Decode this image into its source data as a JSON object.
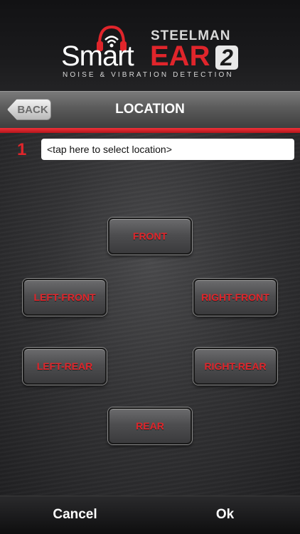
{
  "brand": {
    "company": "STEELMAN",
    "product_prefix": "Smart",
    "product_main": "EAR",
    "product_version": "2",
    "tagline": "NOISE & VIBRATION DETECTION",
    "accent_color": "#e0252b"
  },
  "nav": {
    "back_label": "BACK",
    "title": "LOCATION"
  },
  "location": {
    "number": "1",
    "value": "<tap here to select location>"
  },
  "locations": {
    "front": "FRONT",
    "left_front": "LEFT-FRONT",
    "right_front": "RIGHT-FRONT",
    "left_rear": "LEFT-REAR",
    "right_rear": "RIGHT-REAR",
    "rear": "REAR"
  },
  "footer": {
    "cancel_label": "Cancel",
    "ok_label": "Ok"
  },
  "icons": {
    "logo": "headphone-wifi-icon"
  }
}
